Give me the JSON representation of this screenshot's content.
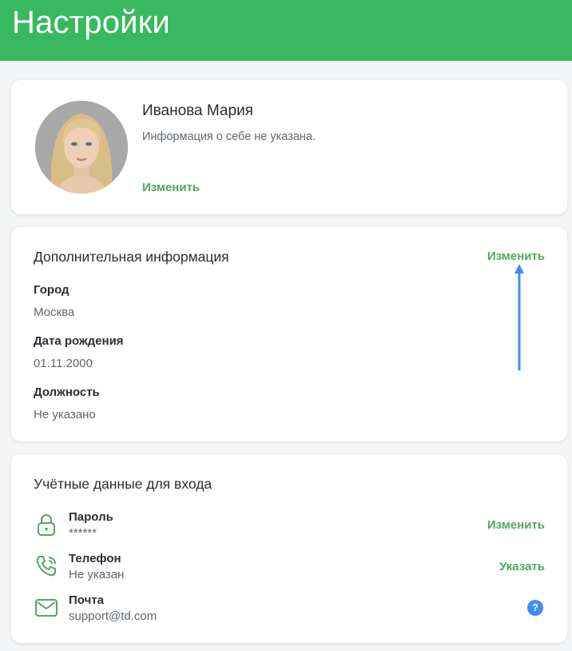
{
  "header": {
    "title": "Настройки"
  },
  "profile": {
    "name": "Иванова Мария",
    "about": "Информация о себе не указана.",
    "edit_label": "Изменить"
  },
  "extra": {
    "title": "Дополнительная информация",
    "edit_label": "Изменить",
    "fields": [
      {
        "label": "Город",
        "value": "Москва"
      },
      {
        "label": "Дата рождения",
        "value": "01.11.2000"
      },
      {
        "label": "Должность",
        "value": "Не указано"
      }
    ]
  },
  "login": {
    "title": "Учётные данные для входа",
    "rows": [
      {
        "icon": "lock-icon",
        "label": "Пароль",
        "value": "******",
        "action": "Изменить"
      },
      {
        "icon": "phone-icon",
        "label": "Телефон",
        "value": "Не указан",
        "action": "Указать"
      },
      {
        "icon": "mail-icon",
        "label": "Почта",
        "value": "support@td.com",
        "help": "?"
      }
    ]
  },
  "colors": {
    "brand_green": "#38b85f",
    "link_green": "#4fa95c",
    "annotation_blue": "#3f8df3"
  }
}
